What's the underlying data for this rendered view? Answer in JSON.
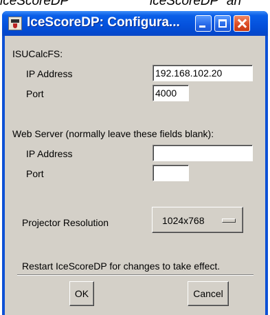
{
  "background": {
    "text_left": "iceScoreDP",
    "text_right": "iceScoreDP” an"
  },
  "window": {
    "title": "IceScoreDP: Configura...",
    "accent_color": "#0d51d6",
    "close_color": "#dd4d25"
  },
  "isu_section": {
    "heading": "ISUCalcFS:",
    "ip_label": "IP Address",
    "ip_value": "192.168.102.20",
    "port_label": "Port",
    "port_value": "4000"
  },
  "web_section": {
    "heading": "Web Server (normally leave these fields blank):",
    "ip_label": "IP Address",
    "ip_value": "",
    "port_label": "Port",
    "port_value": ""
  },
  "projector": {
    "label": "Projector Resolution",
    "value": "1024x768"
  },
  "restart_note": "Restart IceScoreDP for changes to take effect.",
  "buttons": {
    "ok": "OK",
    "cancel": "Cancel"
  },
  "icons": {
    "app": "app-icon",
    "minimize": "minimize-icon",
    "maximize": "maximize-icon",
    "close": "close-icon"
  }
}
